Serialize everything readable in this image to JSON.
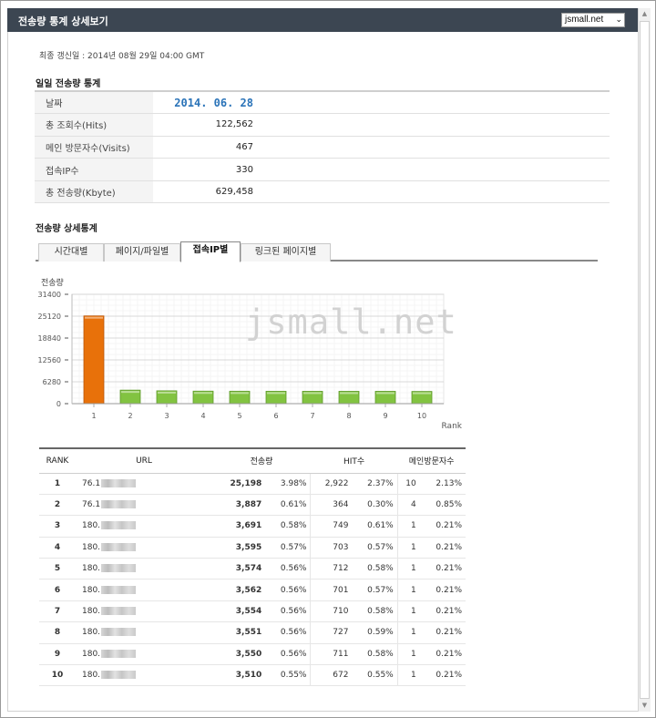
{
  "window": {
    "title": "전송량 통계 상세보기",
    "site_selector": "jsmall.net"
  },
  "updated": "최종 갱신일 : 2014년 08월 29일 04:00 GMT",
  "daily": {
    "title": "일일 전송량 통계",
    "rows": [
      {
        "label": "날짜",
        "value": "2014. 06. 28"
      },
      {
        "label": "총 조회수(Hits)",
        "value": "122,562"
      },
      {
        "label": "메인 방문자수(Visits)",
        "value": "467"
      },
      {
        "label": "접속IP수",
        "value": "330"
      },
      {
        "label": "총 전송량(Kbyte)",
        "value": "629,458"
      }
    ]
  },
  "detail": {
    "title": "전송량 상세통계",
    "tabs": [
      "시간대별",
      "페이지/파일별",
      "접속IP별",
      "링크된 페이지별"
    ],
    "active_tab": 2
  },
  "chart_data": {
    "type": "bar",
    "ylabel": "전송량",
    "xlabel": "Rank",
    "watermark": "jsmall.net",
    "categories": [
      "1",
      "2",
      "3",
      "4",
      "5",
      "6",
      "7",
      "8",
      "9",
      "10"
    ],
    "values": [
      25198,
      3887,
      3691,
      3595,
      3574,
      3562,
      3554,
      3551,
      3550,
      3510
    ],
    "yticks": [
      "0",
      "6280",
      "12560",
      "18840",
      "25120",
      "31400"
    ],
    "ylim": [
      0,
      31400
    ],
    "grid": true,
    "colors": {
      "highlight": "#e8710a",
      "normal": "#82c341"
    }
  },
  "ranking": {
    "headers": [
      "RANK",
      "URL",
      "전송량",
      "HIT수",
      "메인방문자수"
    ],
    "rows": [
      {
        "rank": "1",
        "url": "76.1",
        "kbyte": "25,198",
        "kbyte_pct": "3.98%",
        "hits": "2,922",
        "hits_pct": "2.37%",
        "visits": "10",
        "visits_pct": "2.13%"
      },
      {
        "rank": "2",
        "url": "76.1",
        "kbyte": "3,887",
        "kbyte_pct": "0.61%",
        "hits": "364",
        "hits_pct": "0.30%",
        "visits": "4",
        "visits_pct": "0.85%"
      },
      {
        "rank": "3",
        "url": "180.",
        "kbyte": "3,691",
        "kbyte_pct": "0.58%",
        "hits": "749",
        "hits_pct": "0.61%",
        "visits": "1",
        "visits_pct": "0.21%"
      },
      {
        "rank": "4",
        "url": "180.",
        "kbyte": "3,595",
        "kbyte_pct": "0.57%",
        "hits": "703",
        "hits_pct": "0.57%",
        "visits": "1",
        "visits_pct": "0.21%"
      },
      {
        "rank": "5",
        "url": "180.",
        "kbyte": "3,574",
        "kbyte_pct": "0.56%",
        "hits": "712",
        "hits_pct": "0.58%",
        "visits": "1",
        "visits_pct": "0.21%"
      },
      {
        "rank": "6",
        "url": "180.",
        "kbyte": "3,562",
        "kbyte_pct": "0.56%",
        "hits": "701",
        "hits_pct": "0.57%",
        "visits": "1",
        "visits_pct": "0.21%"
      },
      {
        "rank": "7",
        "url": "180.",
        "kbyte": "3,554",
        "kbyte_pct": "0.56%",
        "hits": "710",
        "hits_pct": "0.58%",
        "visits": "1",
        "visits_pct": "0.21%"
      },
      {
        "rank": "8",
        "url": "180.",
        "kbyte": "3,551",
        "kbyte_pct": "0.56%",
        "hits": "727",
        "hits_pct": "0.59%",
        "visits": "1",
        "visits_pct": "0.21%"
      },
      {
        "rank": "9",
        "url": "180.",
        "kbyte": "3,550",
        "kbyte_pct": "0.56%",
        "hits": "711",
        "hits_pct": "0.58%",
        "visits": "1",
        "visits_pct": "0.21%"
      },
      {
        "rank": "10",
        "url": "180.",
        "kbyte": "3,510",
        "kbyte_pct": "0.55%",
        "hits": "672",
        "hits_pct": "0.55%",
        "visits": "1",
        "visits_pct": "0.21%"
      }
    ]
  }
}
